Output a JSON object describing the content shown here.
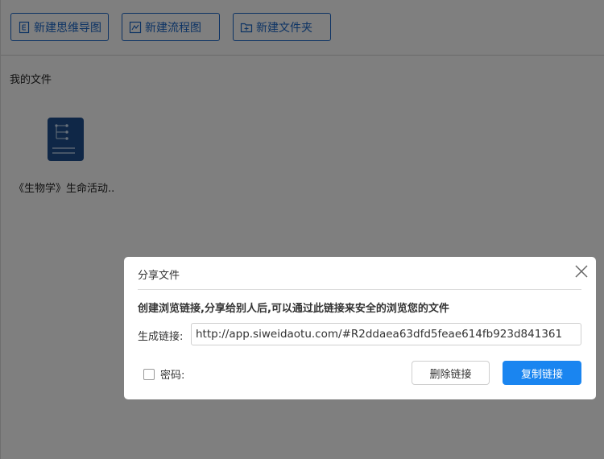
{
  "toolbar": {
    "new_mindmap": "新建思维导图",
    "new_flowchart": "新建流程图",
    "new_folder": "新建文件夹"
  },
  "files": {
    "section_title": "我的文件",
    "items": [
      {
        "name": "《生物学》生命活动..",
        "icon": "mindmap-file-icon"
      }
    ]
  },
  "dialog": {
    "title": "分享文件",
    "description": "创建浏览链接,分享给别人后,可以通过此链接来安全的浏览您的文件",
    "link_label": "生成链接:",
    "link_value": "http://app.siweidaotu.com/#R2ddaea63dfd5feae614fb923d841361",
    "password_label": "密码:",
    "password_checked": false,
    "delete_label": "删除链接",
    "copy_label": "复制链接"
  },
  "colors": {
    "accent": "#1a67c9",
    "primary_button": "#1a85f0",
    "file_icon": "#1f4f8f",
    "overlay": "rgba(0,0,0,0.5)"
  }
}
